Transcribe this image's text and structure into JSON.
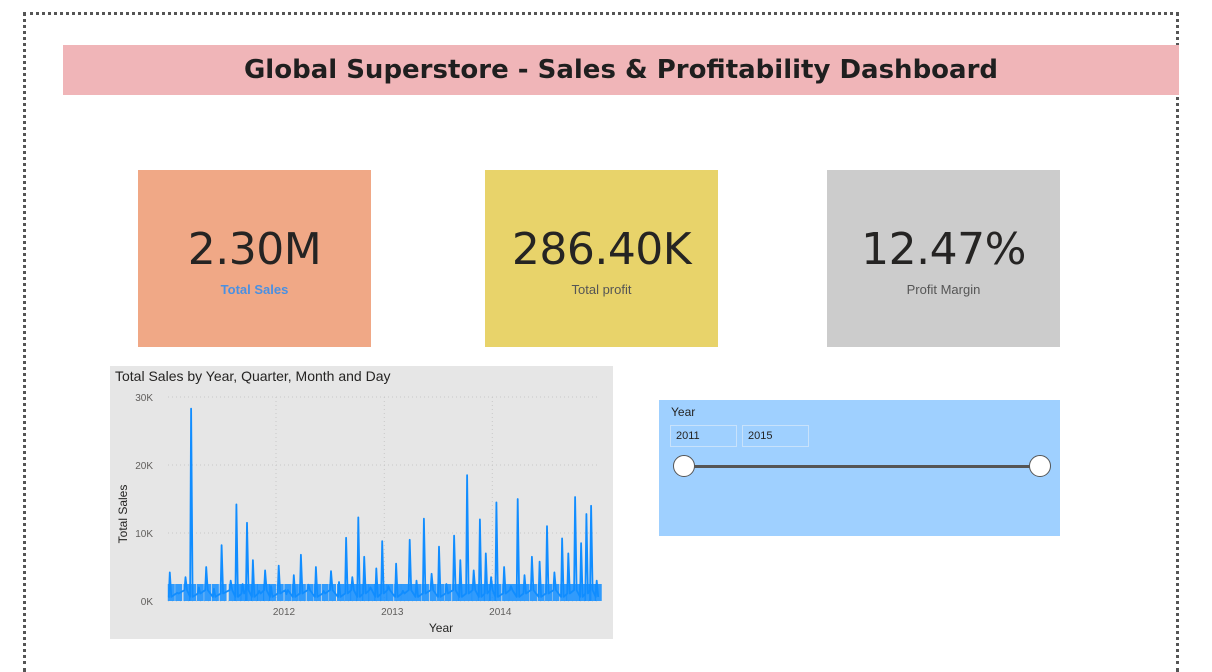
{
  "dashboard": {
    "title": "Global Superstore - Sales & Profitability Dashboard"
  },
  "cards": {
    "sales": {
      "value": "2.30M",
      "label": "Total Sales"
    },
    "profit": {
      "value": "286.40K",
      "label": "Total profit"
    },
    "margin": {
      "value": "12.47%",
      "label": "Profit Margin"
    }
  },
  "chart_data": {
    "type": "line",
    "title": "Total Sales by Year, Quarter, Month and Day",
    "xlabel": "Year",
    "ylabel": "Total Sales",
    "x_ticks": [
      "2012",
      "2013",
      "2014"
    ],
    "y_ticks": [
      "30K",
      "20K",
      "10K",
      "0K"
    ],
    "ylim": [
      0,
      30000
    ],
    "xlim": [
      "2011-01-01",
      "2014-12-31"
    ],
    "grid": true,
    "series_color": "#118dff",
    "series": [
      {
        "x": [
          "2011-01-07",
          "2011-02-01",
          "2011-03-01",
          "2011-03-20",
          "2011-04-15",
          "2011-05-10",
          "2011-06-05",
          "2011-07-01",
          "2011-08-01",
          "2011-08-20",
          "2011-09-10",
          "2011-09-25",
          "2011-10-15",
          "2011-11-05",
          "2011-11-25",
          "2011-12-15",
          "2012-01-10",
          "2012-02-05",
          "2012-03-01",
          "2012-03-25",
          "2012-04-20",
          "2012-05-15",
          "2012-06-10",
          "2012-07-05",
          "2012-08-01",
          "2012-08-25",
          "2012-09-15",
          "2012-10-05",
          "2012-10-25",
          "2012-11-15",
          "2012-12-05",
          "2012-12-25",
          "2013-01-15",
          "2013-02-10",
          "2013-03-05",
          "2013-03-28",
          "2013-04-20",
          "2013-05-15",
          "2013-06-10",
          "2013-07-05",
          "2013-07-30",
          "2013-08-25",
          "2013-09-15",
          "2013-10-08",
          "2013-10-30",
          "2013-11-20",
          "2013-12-10",
          "2013-12-28",
          "2014-01-15",
          "2014-02-10",
          "2014-03-05",
          "2014-03-28",
          "2014-04-20",
          "2014-05-15",
          "2014-06-10",
          "2014-07-05",
          "2014-07-30",
          "2014-08-25",
          "2014-09-15",
          "2014-10-08",
          "2014-10-28",
          "2014-11-15",
          "2014-12-01",
          "2014-12-20"
        ],
        "values": [
          4200,
          1200,
          3500,
          28300,
          2000,
          5000,
          1800,
          8200,
          3000,
          14200,
          2500,
          11500,
          6000,
          1500,
          4500,
          2200,
          5200,
          1000,
          3800,
          6800,
          2400,
          5000,
          1500,
          4400,
          2800,
          9300,
          3500,
          12300,
          6500,
          2000,
          4800,
          8800,
          2200,
          5500,
          1500,
          9000,
          3000,
          12100,
          4000,
          8000,
          2500,
          9600,
          6000,
          18500,
          4500,
          12000,
          7000,
          3500,
          14500,
          5000,
          2200,
          15000,
          3800,
          6500,
          5800,
          11000,
          4200,
          9200,
          7000,
          15300,
          8500,
          12800,
          14000,
          3000
        ]
      }
    ]
  },
  "slicer": {
    "title": "Year",
    "start_value": "2011",
    "end_value": "2015",
    "range_fraction": [
      0,
      1
    ]
  }
}
